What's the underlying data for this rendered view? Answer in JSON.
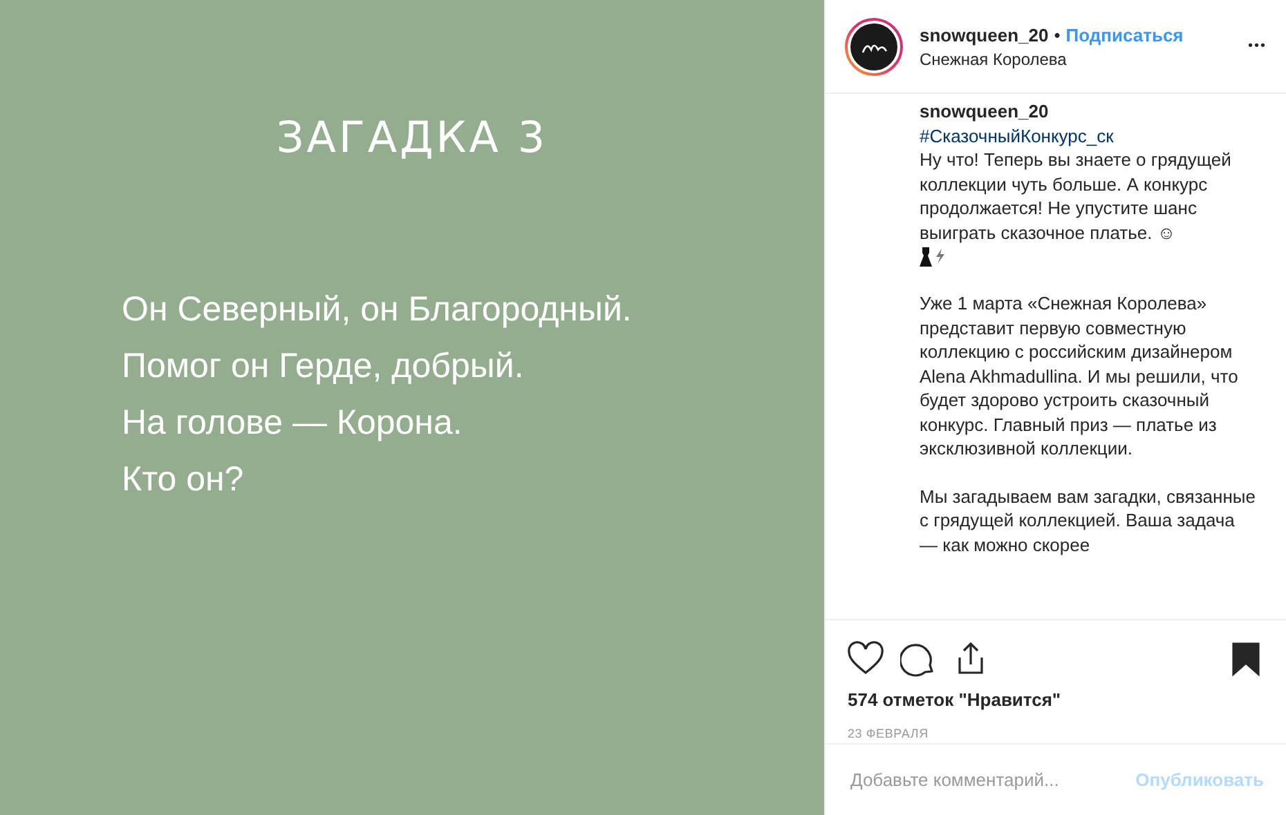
{
  "post_image": {
    "title": "ЗАГАДКА 3",
    "lines": [
      "Он Северный, он Благородный.",
      "Помог он Герде, добрый.",
      "На голове — Корона.",
      "Кто он?"
    ]
  },
  "header": {
    "username": "snowqueen_20",
    "separator": "•",
    "follow": "Подписаться",
    "location": "Снежная Королева",
    "more": "•••"
  },
  "caption": {
    "username": "snowqueen_20",
    "hashtag": "#СказочныйКонкурс_ск",
    "paragraphs": [
      {
        "kind": "text",
        "text": "Ну что! Теперь вы знаете о грядущей коллекции чуть больше. А конкурс продолжается! Не упустите шанс выиграть сказочное платье. ☺"
      },
      {
        "kind": "emoji"
      },
      {
        "kind": "text",
        "text": "Уже 1 марта «Снежная Королева» представит первую совместную коллекцию с российским дизайнером Alena Akhmadullina. И мы решили, что будет здорово устроить сказочный конкурс. Главный приз — платье из эксклюзивной коллекции."
      },
      {
        "kind": "text",
        "text": "Мы загадываем вам загадки, связанные с грядущей коллекцией. Ваша задача — как можно скорее"
      }
    ]
  },
  "actions": {
    "liked": false,
    "saved": true,
    "likes": "574 отметок \"Нравится\"",
    "date": "23 ФЕВРАЛЯ"
  },
  "comment": {
    "placeholder": "Добавьте комментарий...",
    "submit": "Опубликовать",
    "submit_disabled": true
  }
}
